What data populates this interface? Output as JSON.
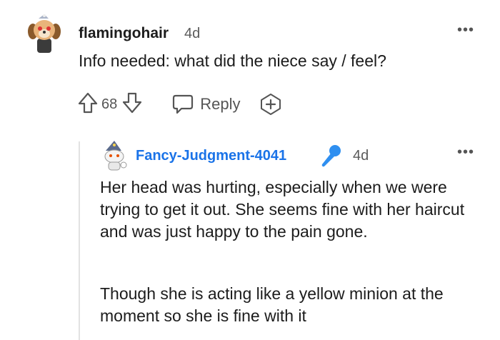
{
  "comment": {
    "avatar_icon": "dog-avatar-icon",
    "username": "flamingohair",
    "time": "4d",
    "more": "•••",
    "body": "Info needed: what did the niece say / feel?",
    "votes": "68",
    "reply_label": "Reply"
  },
  "reply": {
    "avatar_icon": "wizard-snoo-avatar-icon",
    "username": "Fancy-Judgment-4041",
    "mic_icon": "microphone-icon",
    "time": "4d",
    "more": "•••",
    "paragraphs": [
      "Her head was hurting, especially when we were trying to get it out. She seems fine with her haircut and was just happy to the pain gone.",
      "Though she is acting like a yellow minion at the moment so she is fine with it"
    ]
  },
  "colors": {
    "username_link": "#1a73e8",
    "mic_blue": "#2f8ff0",
    "icon_gray": "#555555"
  }
}
